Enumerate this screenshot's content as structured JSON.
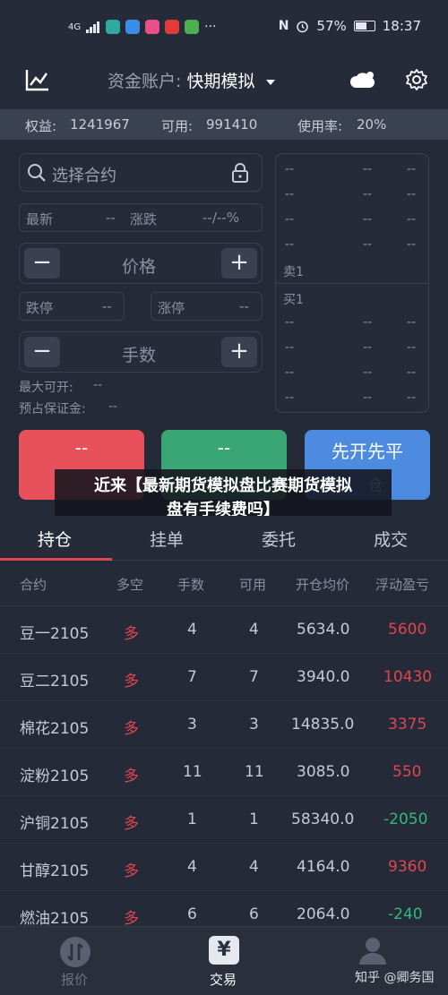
{
  "status_bar": {
    "signal_left": "4G",
    "battery_pct": "57%",
    "time": "18:37",
    "battery_level": 0.57
  },
  "header": {
    "account_label": "资金账户:",
    "account_value": "快期模拟"
  },
  "summary": {
    "equity_label": "权益:",
    "equity_value": "1241967",
    "available_label": "可用:",
    "available_value": "991410",
    "usage_label": "使用率:",
    "usage_value": "20%"
  },
  "order_panel": {
    "search_placeholder": "选择合约",
    "latest_label": "最新",
    "latest_value": "--",
    "change_label": "涨跌",
    "change_value": "--/--%",
    "price_label": "价格",
    "limit_down_label": "跌停",
    "limit_down_value": "--",
    "limit_up_label": "涨停",
    "limit_up_value": "--",
    "qty_label": "手数",
    "max_open_label": "最大可开:",
    "max_open_value": "--",
    "margin_label": "预占保证金:",
    "margin_value": "--",
    "minus": "−",
    "plus": "+"
  },
  "order_book": {
    "sell_label": "卖1",
    "buy_label": "买1",
    "placeholder": "--"
  },
  "actions": {
    "buy_label": "--",
    "sell_label": "--",
    "close_label": "先开先平",
    "close_sub": "仓"
  },
  "overlay": {
    "line1": "近来【最新期货模拟盘比赛期货模拟",
    "line2": "盘有手续费吗】"
  },
  "tabs": [
    "持仓",
    "挂单",
    "委托",
    "成交"
  ],
  "table": {
    "headers": [
      "合约",
      "多空",
      "手数",
      "可用",
      "开仓均价",
      "浮动盈亏"
    ],
    "rows": [
      {
        "contract": "豆一2105",
        "side": "多",
        "qty": "4",
        "avail": "4",
        "avg": "5634.0",
        "pnl": "5600"
      },
      {
        "contract": "豆二2105",
        "side": "多",
        "qty": "7",
        "avail": "7",
        "avg": "3940.0",
        "pnl": "10430"
      },
      {
        "contract": "棉花2105",
        "side": "多",
        "qty": "3",
        "avail": "3",
        "avg": "14835.0",
        "pnl": "3375"
      },
      {
        "contract": "淀粉2105",
        "side": "多",
        "qty": "11",
        "avail": "11",
        "avg": "3085.0",
        "pnl": "550"
      },
      {
        "contract": "沪铜2105",
        "side": "多",
        "qty": "1",
        "avail": "1",
        "avg": "58340.0",
        "pnl": "-2050"
      },
      {
        "contract": "甘醇2105",
        "side": "多",
        "qty": "4",
        "avail": "4",
        "avg": "4164.0",
        "pnl": "9360"
      },
      {
        "contract": "燃油2105",
        "side": "多",
        "qty": "6",
        "avail": "6",
        "avg": "2064.0",
        "pnl": "-240"
      }
    ]
  },
  "bottom_nav": {
    "quote_label": "报价",
    "trade_label": "交易",
    "trade_icon_glyph": "¥",
    "watermark": "知乎 @卿务国"
  },
  "colors": {
    "background": "#252a38",
    "profit": "#e04550",
    "loss": "#33b87c",
    "buy_button": "#e8505b",
    "sell_button": "#3aa575",
    "close_button": "#4c8be0"
  }
}
